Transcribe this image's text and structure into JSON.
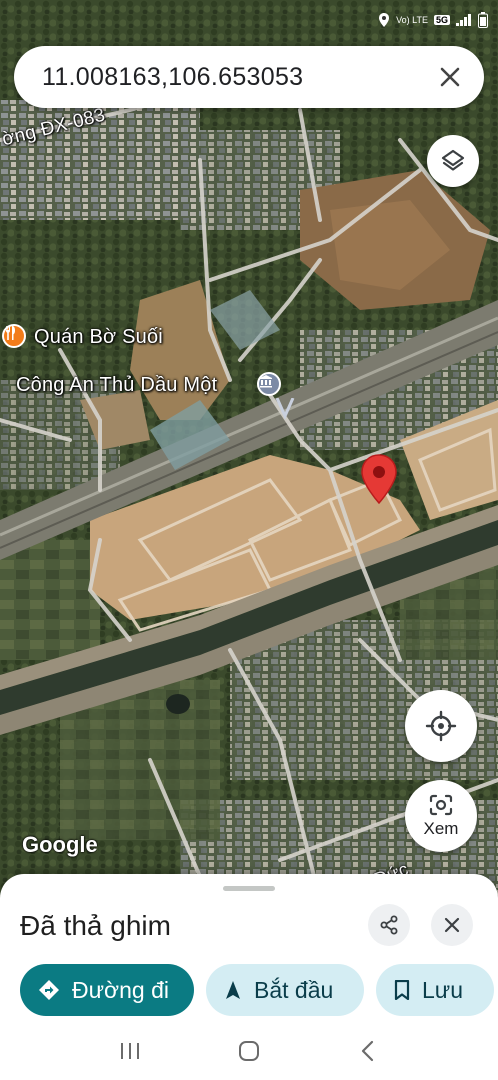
{
  "status_bar": {
    "network_label": "Vo) LTE",
    "signal_badge": "5G"
  },
  "search": {
    "query": "11.008163,106.653053",
    "close_icon": "close-icon"
  },
  "map": {
    "labels": {
      "street_top": "ờng ĐX-083",
      "poi_restaurant": "Quán Bờ Suối",
      "poi_police": "Công An Thủ Dầu Một",
      "street_bottom": "Đức"
    },
    "colors": {
      "restaurant_poi": "#f27c1a",
      "police_poi": "#7c8aa5",
      "pin": "#e53935"
    },
    "lens_label": "Xem",
    "attribution": "Google"
  },
  "sheet": {
    "title": "Đã thả ghim",
    "actions": {
      "directions": "Đường đi",
      "start": "Bắt đầu",
      "save": "Lưu"
    },
    "colors": {
      "primary": "#0b7b83",
      "secondary": "#d4edf3"
    }
  },
  "nav": {
    "recents_icon": "recents-icon",
    "home_icon": "home-icon",
    "back_icon": "back-icon"
  }
}
